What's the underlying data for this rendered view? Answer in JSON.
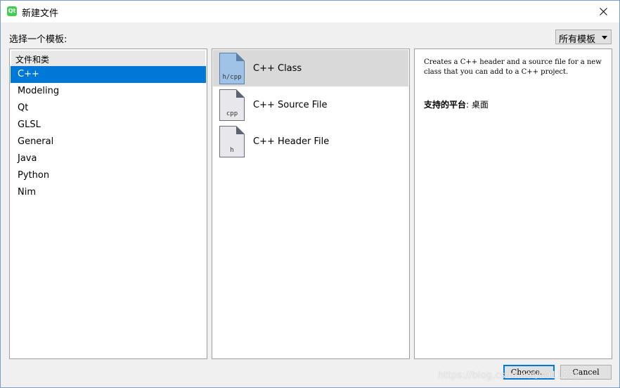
{
  "window": {
    "title": "新建文件",
    "app_icon_text": "Qt"
  },
  "filter": {
    "label": "选择一个模板:",
    "combo_value": "所有模板"
  },
  "categories": {
    "header": "文件和类",
    "items": [
      {
        "label": "C++",
        "selected": true
      },
      {
        "label": "Modeling"
      },
      {
        "label": "Qt"
      },
      {
        "label": "GLSL"
      },
      {
        "label": "General"
      },
      {
        "label": "Java"
      },
      {
        "label": "Python"
      },
      {
        "label": "Nim"
      }
    ]
  },
  "templates": [
    {
      "label": "C++ Class",
      "icon_text": "h/cpp",
      "icon": "class-file-icon",
      "selected": true
    },
    {
      "label": "C++ Source File",
      "icon_text": "cpp",
      "icon": "source-file-icon"
    },
    {
      "label": "C++ Header File",
      "icon_text": "h",
      "icon": "header-file-icon"
    }
  ],
  "description": {
    "text": "Creates a C++ header and a source file for a new class that you can add to a C++ project.",
    "platform_label": "支持的平台",
    "platform_value": ": 桌面"
  },
  "buttons": {
    "choose": "Choose...",
    "cancel": "Cancel"
  },
  "watermark": "https://blog.csdn.net/u011234"
}
